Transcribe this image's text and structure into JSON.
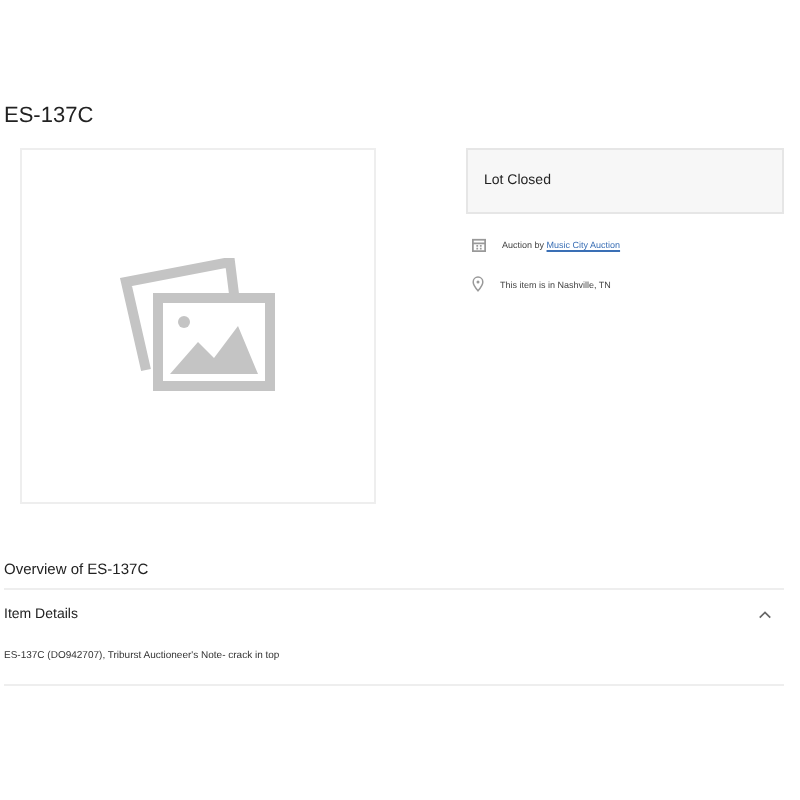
{
  "title": "ES-137C",
  "status": {
    "label": "Lot Closed"
  },
  "auction": {
    "prefix": "Auction by ",
    "link": "Music City Auction"
  },
  "location": {
    "text": "This item is in Nashville, TN"
  },
  "overview": {
    "heading": "Overview of ES-137C"
  },
  "details": {
    "heading": "Item Details",
    "expanded": true,
    "text": "ES-137C (DO942707), Triburst Auctioneer's Note- crack in top"
  }
}
